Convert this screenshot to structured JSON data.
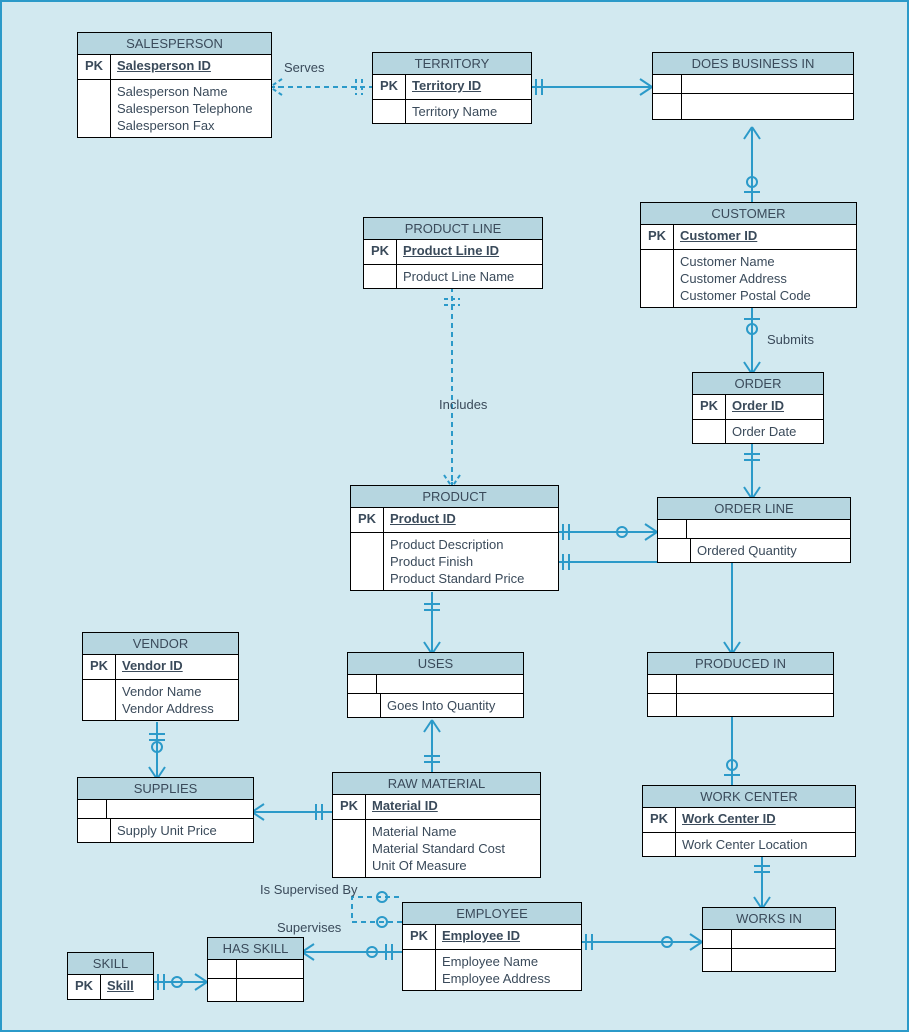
{
  "entities": {
    "salesperson": {
      "title": "SALESPERSON",
      "pk": "PK",
      "key": "Salesperson ID",
      "attrs": [
        "Salesperson Name",
        "Salesperson Telephone",
        "Salesperson Fax"
      ]
    },
    "territory": {
      "title": "TERRITORY",
      "pk": "PK",
      "key": "Territory ID",
      "attrs": [
        "Territory Name"
      ]
    },
    "doesbusiness": {
      "title": "DOES BUSINESS IN"
    },
    "customer": {
      "title": "CUSTOMER",
      "pk": "PK",
      "key": "Customer ID",
      "attrs": [
        "Customer Name",
        "Customer Address",
        "Customer Postal Code"
      ]
    },
    "productline": {
      "title": "PRODUCT LINE",
      "pk": "PK",
      "key": "Product Line ID",
      "attrs": [
        "Product Line Name"
      ]
    },
    "order": {
      "title": "ORDER",
      "pk": "PK",
      "key": "Order ID",
      "attrs": [
        "Order Date"
      ]
    },
    "product": {
      "title": "PRODUCT",
      "pk": "PK",
      "key": "Product ID",
      "attrs": [
        "Product Description",
        "Product Finish",
        "Product Standard Price"
      ]
    },
    "orderline": {
      "title": "ORDER LINE",
      "attrs": [
        "Ordered Quantity"
      ]
    },
    "vendor": {
      "title": "VENDOR",
      "pk": "PK",
      "key": "Vendor ID",
      "attrs": [
        "Vendor Name",
        "Vendor Address"
      ]
    },
    "uses": {
      "title": "USES",
      "attrs": [
        "Goes Into Quantity"
      ]
    },
    "producedin": {
      "title": "PRODUCED IN"
    },
    "supplies": {
      "title": "SUPPLIES",
      "attrs": [
        "Supply Unit Price"
      ]
    },
    "rawmaterial": {
      "title": "RAW MATERIAL",
      "pk": "PK",
      "key": "Material ID",
      "attrs": [
        "Material Name",
        "Material Standard Cost",
        "Unit Of Measure"
      ]
    },
    "workcenter": {
      "title": "WORK CENTER",
      "pk": "PK",
      "key": "Work Center ID",
      "attrs": [
        "Work Center Location"
      ]
    },
    "employee": {
      "title": "EMPLOYEE",
      "pk": "PK",
      "key": "Employee ID",
      "attrs": [
        "Employee Name",
        "Employee Address"
      ]
    },
    "worksin": {
      "title": "WORKS IN"
    },
    "skill": {
      "title": "SKILL",
      "pk": "PK",
      "key": "Skill"
    },
    "hasskill": {
      "title": "HAS SKILL"
    }
  },
  "relationships": {
    "serves": "Serves",
    "includes": "Includes",
    "submits": "Submits",
    "supervises": "Supervises",
    "issupervised": "Is Supervised By"
  }
}
